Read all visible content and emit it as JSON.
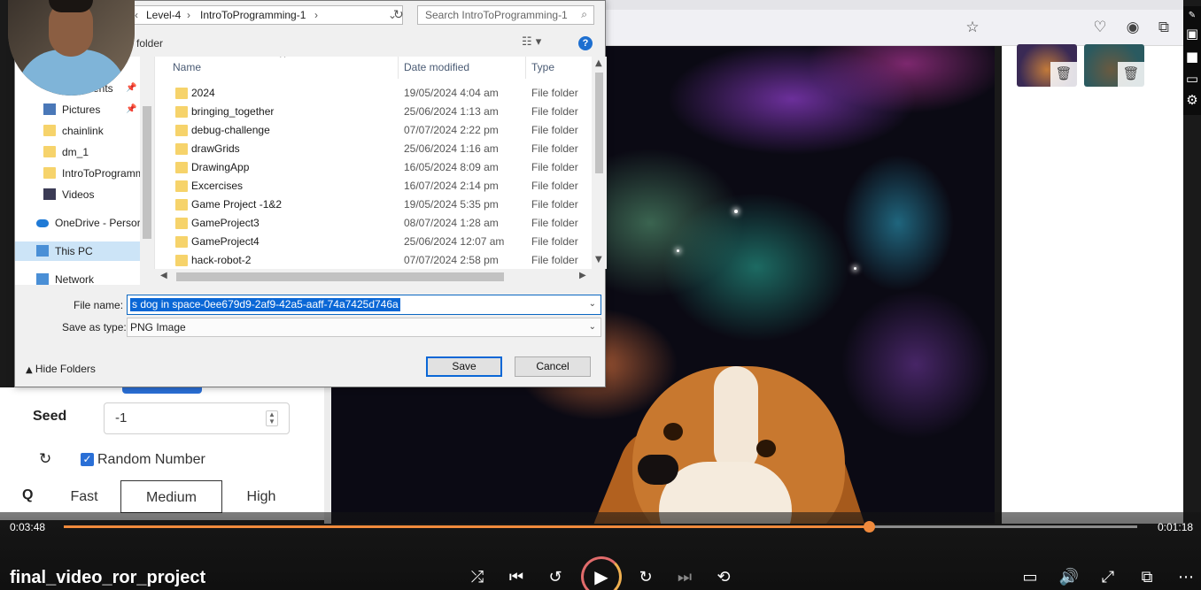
{
  "dialog": {
    "breadcrumb": [
      "Level-4",
      "IntroToProgramming-1"
    ],
    "search_placeholder": "Search IntroToProgramming-1",
    "new_folder_label": "folder",
    "nav_items": [
      {
        "label": "ents",
        "icon": "documents-icon"
      },
      {
        "label": "Pictures",
        "icon": "pictures-icon"
      },
      {
        "label": "chainlink",
        "icon": "folder-icon"
      },
      {
        "label": "dm_1",
        "icon": "folder-icon"
      },
      {
        "label": "IntroToProgramm",
        "icon": "folder-icon"
      },
      {
        "label": "Videos",
        "icon": "videos-icon"
      },
      {
        "label": "OneDrive - Persor",
        "icon": "onedrive-icon"
      },
      {
        "label": "This PC",
        "icon": "computer-icon"
      },
      {
        "label": "Network",
        "icon": "network-icon"
      }
    ],
    "columns": {
      "name": "Name",
      "date": "Date modified",
      "type": "Type"
    },
    "files": [
      {
        "name": "2024",
        "date": "19/05/2024 4:04 am",
        "type": "File folder"
      },
      {
        "name": "bringing_together",
        "date": "25/06/2024 1:13 am",
        "type": "File folder"
      },
      {
        "name": "debug-challenge",
        "date": "07/07/2024 2:22 pm",
        "type": "File folder"
      },
      {
        "name": "drawGrids",
        "date": "25/06/2024 1:16 am",
        "type": "File folder"
      },
      {
        "name": "DrawingApp",
        "date": "16/05/2024 8:09 am",
        "type": "File folder"
      },
      {
        "name": "Excercises",
        "date": "16/07/2024 2:14 pm",
        "type": "File folder"
      },
      {
        "name": "Game Project -1&2",
        "date": "19/05/2024 5:35 pm",
        "type": "File folder"
      },
      {
        "name": "GameProject3",
        "date": "08/07/2024 1:28 am",
        "type": "File folder"
      },
      {
        "name": "GameProject4",
        "date": "25/06/2024 12:07 am",
        "type": "File folder"
      },
      {
        "name": "hack-robot-2",
        "date": "07/07/2024 2:58 pm",
        "type": "File folder"
      }
    ],
    "file_name_label": "File name:",
    "file_name_value": "s dog in space-0ee679d9-2af9-42a5-aaff-74a7425d746a",
    "save_type_label": "Save as type:",
    "save_type_value": "PNG Image",
    "hide_folders_label": "Hide Folders",
    "save_button": "Save",
    "cancel_button": "Cancel"
  },
  "app": {
    "seed_label": "Seed",
    "seed_value": "-1",
    "random_number_label": "Random Number",
    "random_number_checked": true,
    "quality_label": "Q",
    "quality_options": [
      "Fast",
      "Medium",
      "High"
    ],
    "quality_selected": "Medium"
  },
  "player": {
    "elapsed": "0:03:48",
    "remaining": "0:01:18",
    "progress_fraction": 0.75,
    "title": "final_video_ror_project",
    "accent_color": "#f08a3c"
  }
}
